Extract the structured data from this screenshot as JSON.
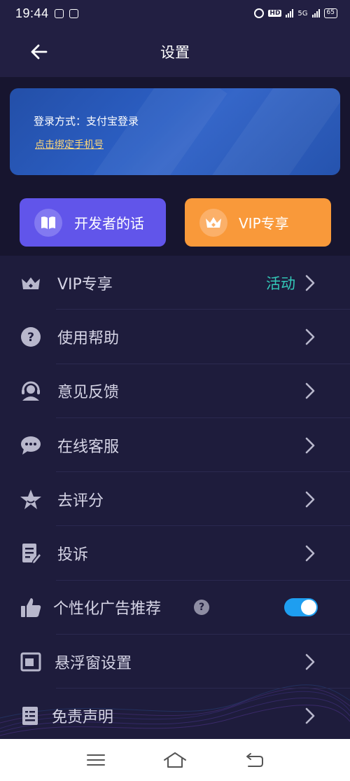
{
  "status_bar": {
    "time": "19:44",
    "hd_label": "HD",
    "network_label": "5G",
    "battery": "65"
  },
  "nav": {
    "title": "设置",
    "back_icon": "arrow-left-icon"
  },
  "account": {
    "login_method": "登录方式：支付宝登录",
    "bind_phone_link": "点击绑定手机号"
  },
  "quick_actions": {
    "developer": {
      "label": "开发者的话",
      "icon": "book-icon",
      "color": "#6155ea"
    },
    "vip": {
      "label": "VIP专享",
      "icon": "crown-icon",
      "color": "#f9993a"
    }
  },
  "menu": {
    "items": [
      {
        "label": "VIP专享",
        "icon": "crown-icon",
        "tag": "活动"
      },
      {
        "label": "使用帮助",
        "icon": "help-icon"
      },
      {
        "label": "意见反馈",
        "icon": "headset-icon"
      },
      {
        "label": "在线客服",
        "icon": "chat-icon"
      },
      {
        "label": "去评分",
        "icon": "star-icon"
      },
      {
        "label": "投诉",
        "icon": "edit-document-icon"
      },
      {
        "label": "个性化广告推荐",
        "icon": "thumbs-up-icon",
        "help_mark": "?",
        "toggle_on": true
      },
      {
        "label": "悬浮窗设置",
        "icon": "floating-window-icon"
      },
      {
        "label": "免责声明",
        "icon": "document-icon"
      }
    ]
  },
  "colors": {
    "background": "#1e1c3c",
    "accent_teal": "#33c9b8",
    "toggle_blue": "#1e9ef0",
    "link_yellow": "#ffd87a"
  }
}
